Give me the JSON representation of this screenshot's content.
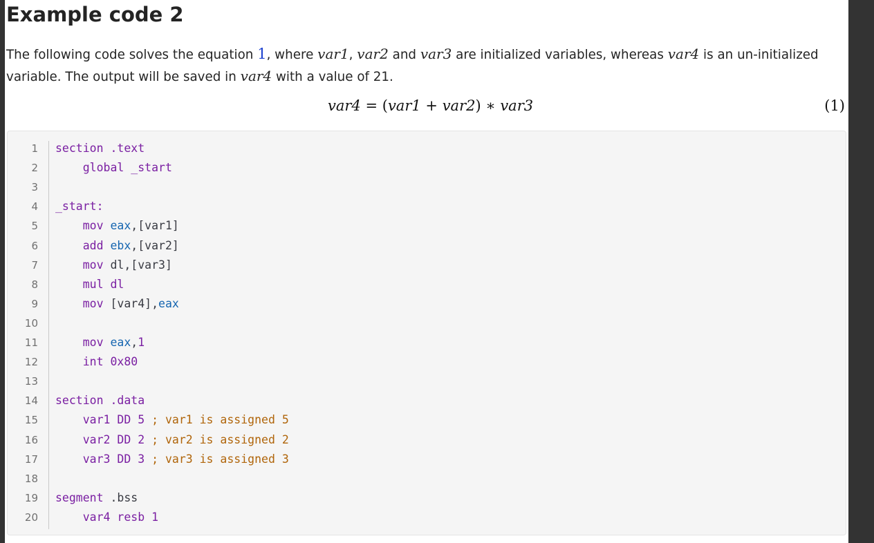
{
  "heading": "Example code 2",
  "intro": {
    "t1": "The following code solves the equation ",
    "ref": "1",
    "t2": ", where ",
    "v1": "var1",
    "t3": ", ",
    "v2": "var2",
    "t4": " and ",
    "v3": "var3",
    "t5": " are initialized variables, whereas ",
    "v4": "var4",
    "t6": " is an un-initialized variable. The output will be saved in ",
    "v5": "var4",
    "t7": " with a value of 21."
  },
  "equation": {
    "lhs": "var4",
    "eq": " = (",
    "a": "var1",
    "plus": " + ",
    "b": "var2",
    "times": ") ∗ ",
    "c": "var3",
    "number": "(1)"
  },
  "code": {
    "lines": [
      {
        "n": "1",
        "tokens": [
          {
            "t": "section",
            "c": "kw"
          },
          {
            "t": " .text",
            "c": "num"
          }
        ]
      },
      {
        "n": "2",
        "tokens": [
          {
            "t": "    global",
            "c": "kw"
          },
          {
            "t": " _start",
            "c": "num"
          }
        ]
      },
      {
        "n": "3",
        "tokens": []
      },
      {
        "n": "4",
        "tokens": [
          {
            "t": "_start:",
            "c": "kw"
          }
        ]
      },
      {
        "n": "5",
        "tokens": [
          {
            "t": "    mov ",
            "c": "kw"
          },
          {
            "t": "eax",
            "c": "reg"
          },
          {
            "t": ",[var1]",
            "c": "pl"
          }
        ]
      },
      {
        "n": "6",
        "tokens": [
          {
            "t": "    add ",
            "c": "kw"
          },
          {
            "t": "ebx",
            "c": "reg"
          },
          {
            "t": ",[var2]",
            "c": "pl"
          }
        ]
      },
      {
        "n": "7",
        "tokens": [
          {
            "t": "    mov ",
            "c": "kw"
          },
          {
            "t": "dl",
            "c": "pl"
          },
          {
            "t": ",[var3]",
            "c": "pl"
          }
        ]
      },
      {
        "n": "8",
        "tokens": [
          {
            "t": "    mul ",
            "c": "kw"
          },
          {
            "t": "dl",
            "c": "kw"
          }
        ]
      },
      {
        "n": "9",
        "tokens": [
          {
            "t": "    mov ",
            "c": "kw"
          },
          {
            "t": "[var4],",
            "c": "pl"
          },
          {
            "t": "eax",
            "c": "reg"
          }
        ]
      },
      {
        "n": "10",
        "tokens": []
      },
      {
        "n": "11",
        "tokens": [
          {
            "t": "    mov ",
            "c": "kw"
          },
          {
            "t": "eax",
            "c": "reg"
          },
          {
            "t": ",",
            "c": "pl"
          },
          {
            "t": "1",
            "c": "num"
          }
        ]
      },
      {
        "n": "12",
        "tokens": [
          {
            "t": "    int ",
            "c": "kw"
          },
          {
            "t": "0x80",
            "c": "num"
          }
        ]
      },
      {
        "n": "13",
        "tokens": []
      },
      {
        "n": "14",
        "tokens": [
          {
            "t": "section",
            "c": "kw"
          },
          {
            "t": " .data",
            "c": "num"
          }
        ]
      },
      {
        "n": "15",
        "tokens": [
          {
            "t": "    var1 ",
            "c": "kw"
          },
          {
            "t": "DD ",
            "c": "kw"
          },
          {
            "t": "5",
            "c": "num"
          },
          {
            "t": " ; var1 is assigned 5",
            "c": "cm"
          }
        ]
      },
      {
        "n": "16",
        "tokens": [
          {
            "t": "    var2 ",
            "c": "kw"
          },
          {
            "t": "DD ",
            "c": "kw"
          },
          {
            "t": "2",
            "c": "num"
          },
          {
            "t": " ; var2 is assigned 2",
            "c": "cm"
          }
        ]
      },
      {
        "n": "17",
        "tokens": [
          {
            "t": "    var3 ",
            "c": "kw"
          },
          {
            "t": "DD ",
            "c": "kw"
          },
          {
            "t": "3",
            "c": "num"
          },
          {
            "t": " ; var3 is assigned 3",
            "c": "cm"
          }
        ]
      },
      {
        "n": "18",
        "tokens": []
      },
      {
        "n": "19",
        "tokens": [
          {
            "t": "segment",
            "c": "kw"
          },
          {
            "t": " .bss",
            "c": "pl"
          }
        ]
      },
      {
        "n": "20",
        "tokens": [
          {
            "t": "    var4 ",
            "c": "kw"
          },
          {
            "t": "resb ",
            "c": "kw"
          },
          {
            "t": "1",
            "c": "num"
          }
        ]
      }
    ]
  },
  "colors": {
    "keyword": "#7a1fa2",
    "register": "#1565b0",
    "comment": "#b0650a",
    "link": "#1a3fcf"
  }
}
